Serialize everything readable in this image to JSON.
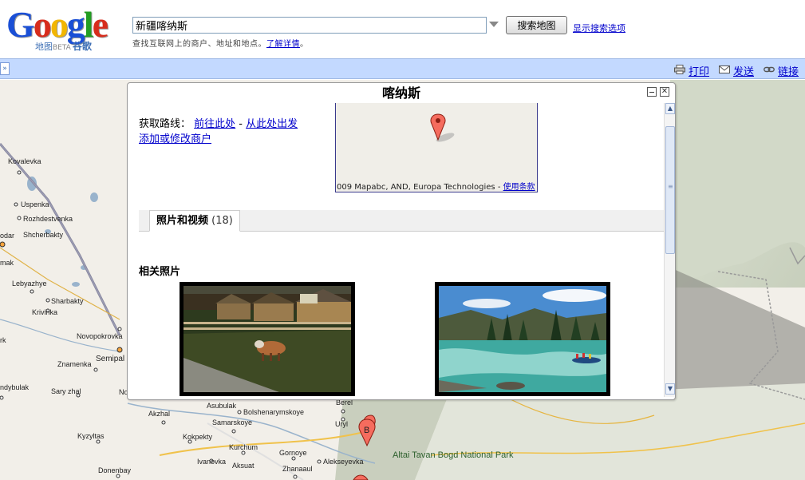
{
  "header": {
    "logo": {
      "brand_letters": [
        "G",
        "o",
        "o",
        "g",
        "l",
        "e"
      ],
      "brand_colors": [
        "#1a4fd6",
        "#d72d1d",
        "#f2b602",
        "#1a4fd6",
        "#239e23",
        "#d72d1d"
      ],
      "maps_label": "地图",
      "beta_label": "BETA",
      "chinese_brand": "谷歌"
    },
    "search": {
      "value": "新疆喀纳斯",
      "button_label": "搜索地图",
      "show_options_label": "显示搜索选项",
      "hint_text": "查找互联网上的商户、地址和地点。",
      "hint_link": "了解详情",
      "hint_suffix": "。"
    }
  },
  "toolbar": {
    "collapse_label": "»",
    "print_label": "打印",
    "send_label": "发送",
    "link_label": "链接"
  },
  "infowindow": {
    "title": "喀纳斯",
    "directions_label": "获取路线：",
    "directions_to": "前往此处",
    "directions_sep": " - ",
    "directions_from": "从此处出发",
    "edit_business": "添加或修改商户",
    "minimap_copyright": "009 Mapabc, AND, Europa Technologies - ",
    "minimap_terms": "使用条款",
    "tab": {
      "label": "照片和视频",
      "count": "(18)"
    },
    "photos_heading": "相关照片",
    "scroll_up": "▲",
    "scroll_down": "▼",
    "close_label": "✕"
  },
  "map": {
    "places": [
      {
        "name": "Kovalevka"
      },
      {
        "name": "Uspenka"
      },
      {
        "name": "Rozhdestvenka"
      },
      {
        "name": "Shcherbakty"
      },
      {
        "name": "Lebyazhye"
      },
      {
        "name": "Sharbakty"
      },
      {
        "name": "Krivinka"
      },
      {
        "name": "Novopokrovka"
      },
      {
        "name": "Semipal"
      },
      {
        "name": "Znamenka"
      },
      {
        "name": "Sary zhal"
      },
      {
        "name": "ndybulak"
      },
      {
        "name": "No"
      },
      {
        "name": "Akzhal"
      },
      {
        "name": "Asubulak"
      },
      {
        "name": "Bolshenarymskoye"
      },
      {
        "name": "Berel"
      },
      {
        "name": "Samarskoye"
      },
      {
        "name": "Uryl"
      },
      {
        "name": "Kyzyltas"
      },
      {
        "name": "Kokpekty"
      },
      {
        "name": "Kurchum"
      },
      {
        "name": "Gornoye"
      },
      {
        "name": "Ivanovka"
      },
      {
        "name": "Aksuat"
      },
      {
        "name": "Alekseyevka"
      },
      {
        "name": "Zhanaaul"
      },
      {
        "name": "Donenbay"
      },
      {
        "name": "mak"
      },
      {
        "name": "odar"
      },
      {
        "name": "rk"
      }
    ],
    "park_label": "Altai Tavan Bogd National Park",
    "marker_b_label": "B"
  }
}
